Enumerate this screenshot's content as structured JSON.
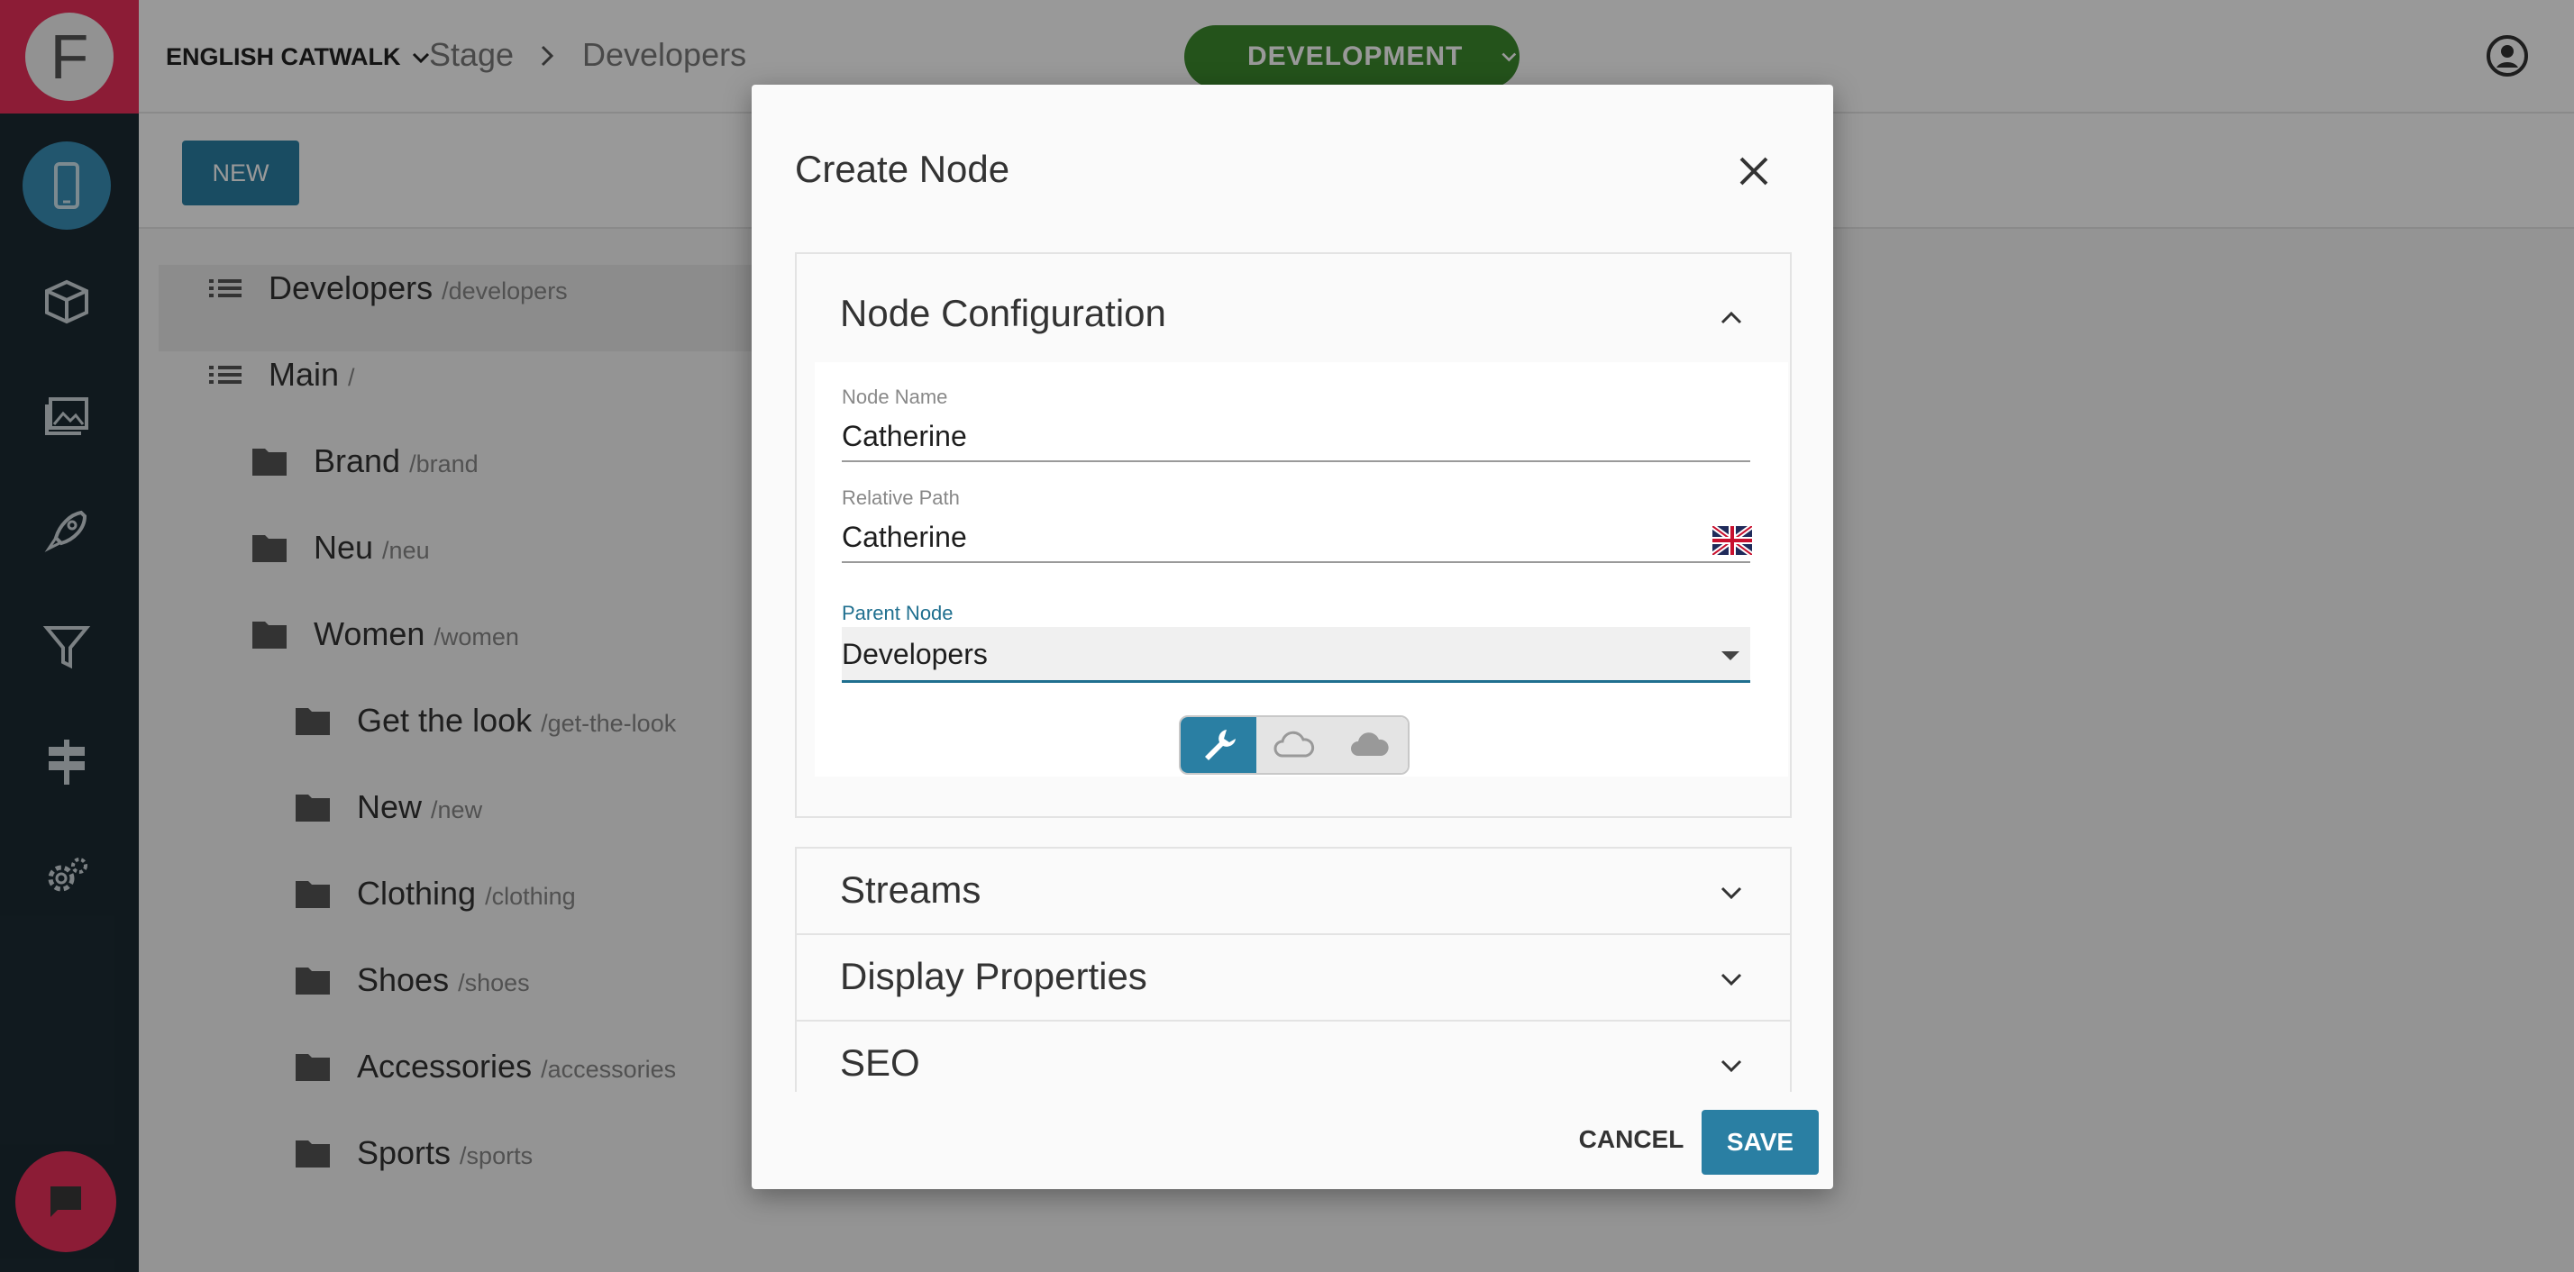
{
  "brand": {
    "logo_letter": "F",
    "accent": "#ea2f5a",
    "primary": "#2a7fa3"
  },
  "topbar": {
    "app_selector": "ENGLISH CATWALK",
    "breadcrumb": [
      "Stage",
      "Developers"
    ],
    "environment": "DEVELOPMENT"
  },
  "toolbar": {
    "new_label": "NEW"
  },
  "tree": {
    "rows": [
      {
        "name": "Developers",
        "path": "/developers",
        "icon": "list-icon"
      },
      {
        "name": "Main",
        "path": "/",
        "icon": "list-icon"
      },
      {
        "name": "Brand",
        "path": "/brand",
        "icon": "folder-icon"
      },
      {
        "name": "Neu",
        "path": "/neu",
        "icon": "folder-icon"
      },
      {
        "name": "Women",
        "path": "/women",
        "icon": "folder-icon"
      },
      {
        "name": "Get the look",
        "path": "/get-the-look",
        "icon": "folder-icon"
      },
      {
        "name": "New",
        "path": "/new",
        "icon": "folder-icon"
      },
      {
        "name": "Clothing",
        "path": "/clothing",
        "icon": "folder-icon"
      },
      {
        "name": "Shoes",
        "path": "/shoes",
        "icon": "folder-icon"
      },
      {
        "name": "Accessories",
        "path": "/accessories",
        "icon": "folder-icon"
      },
      {
        "name": "Sports",
        "path": "/sports",
        "icon": "folder-icon"
      }
    ]
  },
  "modal": {
    "title": "Create Node",
    "config": {
      "heading": "Node Configuration",
      "node_name_label": "Node Name",
      "node_name_value": "Catherine",
      "relative_path_label": "Relative Path",
      "relative_path_value": "Catherine",
      "parent_node_label": "Parent Node",
      "parent_node_value": "Developers"
    },
    "sections": [
      "Streams",
      "Display Properties",
      "SEO"
    ],
    "cancel_label": "CANCEL",
    "save_label": "SAVE"
  }
}
